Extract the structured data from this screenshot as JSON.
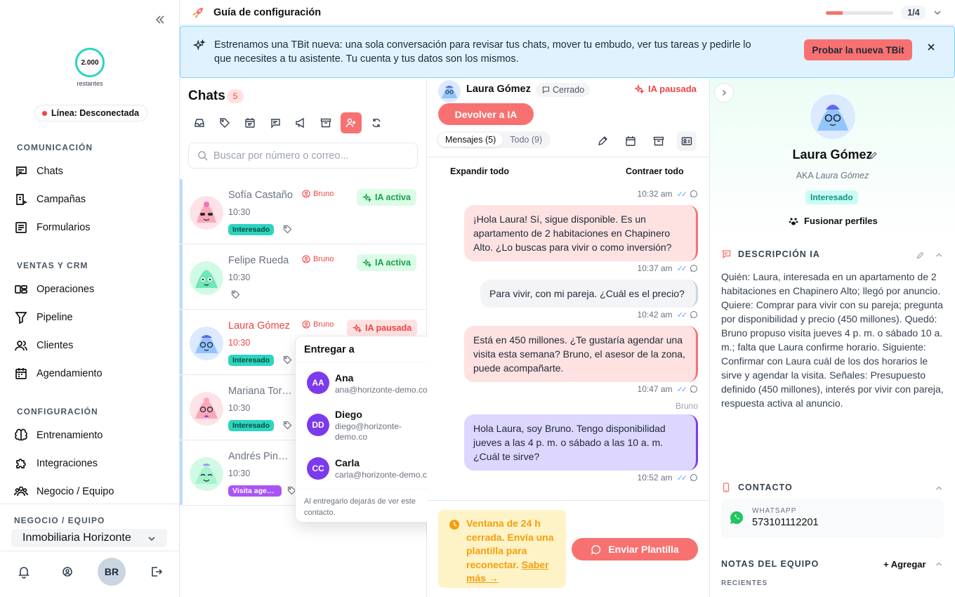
{
  "sidebar": {
    "credits_value": "2.000",
    "credits_label": "restantes",
    "line_status": "Línea: Desconectada",
    "sections": [
      {
        "title": "COMUNICACIÓN",
        "items": [
          {
            "label": "Chats",
            "icon": "chat-icon"
          },
          {
            "label": "Campañas",
            "icon": "campaign-icon"
          },
          {
            "label": "Formularios",
            "icon": "form-icon"
          }
        ]
      },
      {
        "title": "VENTAS Y CRM",
        "items": [
          {
            "label": "Operaciones",
            "icon": "operations-icon"
          },
          {
            "label": "Pipeline",
            "icon": "funnel-icon"
          },
          {
            "label": "Clientes",
            "icon": "users-icon"
          },
          {
            "label": "Agendamiento",
            "icon": "calendar-icon"
          }
        ]
      },
      {
        "title": "CONFIGURACIÓN",
        "items": [
          {
            "label": "Entrenamiento",
            "icon": "brain-icon"
          },
          {
            "label": "Integraciones",
            "icon": "puzzle-icon"
          },
          {
            "label": "Negocio / Equipo",
            "icon": "team-icon"
          }
        ]
      }
    ],
    "business_label": "NEGOCIO / EQUIPO",
    "business_name": "Inmobiliaria Horizonte",
    "user_initials": "BR"
  },
  "topbar": {
    "title": "Guía de configuración",
    "progress": 0.25,
    "step": "1/4"
  },
  "banner": {
    "text": "Estrenamos una TBit nueva: una sola conversación para revisar tus chats, mover tu embudo, ver tus tareas y pedirle lo que necesites a tu asistente. Tu cuenta y tus datos son los mismos.",
    "button": "Probar la nueva TBit"
  },
  "chats": {
    "title": "Chats",
    "count": "5",
    "search_placeholder": "Buscar por número o correo...",
    "items": [
      {
        "name": "Sofía Castaño",
        "time": "10:30",
        "agent": "Bruno",
        "ia": "IA activa",
        "tag": "Interesado"
      },
      {
        "name": "Felipe Rueda",
        "time": "10:30",
        "agent": "Bruno",
        "ia": "IA activa",
        "tag": ""
      },
      {
        "name": "Laura Gómez",
        "time": "10:30",
        "agent": "Bruno",
        "ia": "IA pausada",
        "tag": "Interesado"
      },
      {
        "name": "Mariana Torres",
        "time": "10:30",
        "agent": "",
        "ia": "",
        "tag": "Interesado"
      },
      {
        "name": "Andrés Pinedo",
        "time": "10:30",
        "agent": "",
        "ia": "",
        "tag": "Visita agendada"
      }
    ]
  },
  "handoff": {
    "title": "Entregar a",
    "agents": [
      {
        "initials": "AA",
        "name": "Ana",
        "email": "ana@horizonte-demo.co"
      },
      {
        "initials": "DD",
        "name": "Diego",
        "email": "diego@horizonte-demo.co"
      },
      {
        "initials": "CC",
        "name": "Carla",
        "email": "carla@horizonte-demo.co"
      }
    ],
    "footer": "Al entregarlo dejarás de ver este contacto."
  },
  "conversation": {
    "contact_name": "Laura Gómez",
    "status": "Cerrado",
    "ia_status": "IA pausada",
    "return_button": "Devolver a IA",
    "tabs": [
      "Mensajes (5)",
      "Todo (9)"
    ],
    "expand_all": "Expandir todo",
    "contract_all": "Contraer todo",
    "messages": [
      {
        "time": "10:32 am",
        "text": ""
      },
      {
        "text": "¡Hola Laura! Sí, sigue disponible. Es un apartamento de 2 habitaciones en Chapinero Alto. ¿Lo buscas para vivir o como inversión?",
        "time": "10:37 am"
      },
      {
        "text": "Para vivir, con mi pareja. ¿Cuál es el precio?",
        "time": "10:42 am"
      },
      {
        "text": "Está en 450 millones. ¿Te gustaría agendar una visita esta semana? Bruno, el asesor de la zona, puede acompañarte.",
        "time": "10:47 am"
      },
      {
        "sender": "Bruno",
        "text": "Hola Laura, soy Bruno. Tengo disponibilidad jueves a las 4 p. m. o sábado a las 10 a. m. ¿Cuál te sirve?",
        "time": "10:52 am"
      }
    ],
    "window_note": "Ventana de 24 h cerrada. Envía una plantilla para reconectar.",
    "window_link": "Saber más →",
    "send_template": "Enviar Plantilla"
  },
  "profile": {
    "name": "Laura Gómez",
    "aka_prefix": "AKA",
    "aka_name": "Laura Gómez",
    "tag": "Interesado",
    "merge": "Fusionar perfiles",
    "ia_description_title": "DESCRIPCIÓN IA",
    "ia_description": "Quién: Laura, interesada en un apartamento de 2 habitaciones en Chapinero Alto; llegó por anuncio. Quiere: Comprar para vivir con su pareja; pregunta por disponibilidad y precio (450 millones). Quedó: Bruno propuso visita jueves 4 p. m. o sábado 10 a. m.; falta que Laura confirme horario. Siguiente: Confirmar con Laura cuál de los dos horarios le sirve y agendar la visita. Señales: Presupuesto definido (450 millones), interés por vivir con pareja, respuesta activa al anuncio.",
    "contact_title": "CONTACTO",
    "whatsapp_label": "WHATSAPP",
    "whatsapp_number": "573101112201",
    "notes_title": "NOTAS DEL EQUIPO",
    "add_note": "+ Agregar",
    "recent_label": "RECIENTES"
  },
  "colors": {
    "accent": "#f87171",
    "success": "#16a34a",
    "teal": "#2dd4bf",
    "purple": "#7c3aed"
  }
}
